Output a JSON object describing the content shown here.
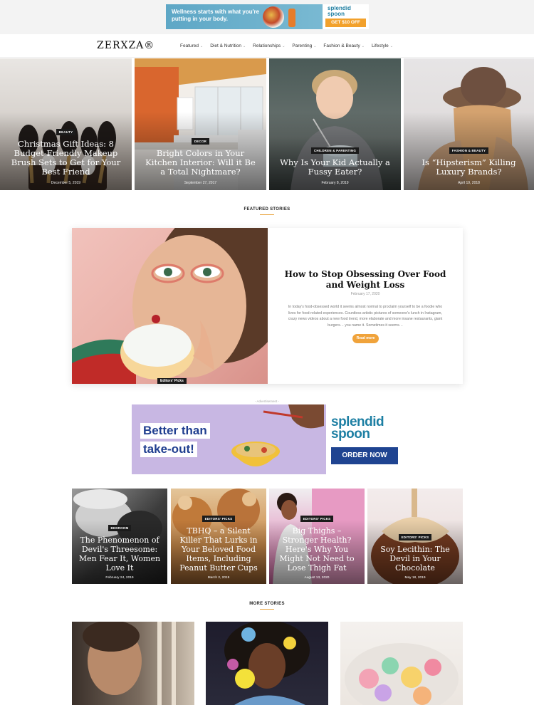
{
  "top_ad": {
    "text": "Wellness starts with what you're putting in your body.",
    "brand": "splendid spoon",
    "cta": "GET $10 OFF"
  },
  "header": {
    "logo": "ZERXZA®",
    "nav": [
      {
        "label": "Featured"
      },
      {
        "label": "Diet & Nutrition"
      },
      {
        "label": "Relationships"
      },
      {
        "label": "Parenting"
      },
      {
        "label": "Fashion & Beauty"
      },
      {
        "label": "Lifestyle"
      }
    ]
  },
  "hero_posts": [
    {
      "category": "BEAUTY",
      "title": "Christmas Gift Ideas: 8 Budget-Friendly Makeup Brush Sets to Get for Your Best Friend",
      "date": "December 5, 2019"
    },
    {
      "category": "DECOR",
      "title": "Bright Colors in Your Kitchen Interior: Will it Be a Total Nightmare?",
      "date": "September 27, 2017"
    },
    {
      "category": "CHILDREN & PARENTING",
      "title": "Why Is Your Kid Actually a Fussy Eater?",
      "date": "February 8, 2019"
    },
    {
      "category": "FASHION & BEAUTY",
      "title": "Is “Hipsterism” Killing Luxury Brands?",
      "date": "April 19, 2018"
    }
  ],
  "featured": {
    "heading": "FEATURED STORIES",
    "title": "How to Stop Obsessing Over Food and Weight Loss",
    "date": "February 17, 2020",
    "excerpt": "In today's food-obsessed world it seems almost normal to proclaim yourself to be a foodie who lives for food-related experiences. Countless artistic pictures of someone's lunch in Instagram, crazy news videos about a new food trend, more elaborate and more insane restaurants, giant burgers… you name it. Sometimes it seems…",
    "button": "Read more",
    "badge": "Editors' Picks"
  },
  "mid_ad": {
    "label": "- Advertisement -",
    "line1": "Better than",
    "line2": "take-out!",
    "brand_line1": "splendid",
    "brand_line2": "spoon",
    "cta": "ORDER NOW"
  },
  "grid_posts": [
    {
      "category": "BEDROOM",
      "title": "The Phenomenon of Devil's Threesome: Men Fear It, Women Love It",
      "date": "February 24, 2019"
    },
    {
      "category": "EDITORS' PICKS",
      "title": "TBHQ – a Silent Killer That Lurks in Your Beloved Food Items, Including Peanut Butter Cups",
      "date": "March 2, 2019"
    },
    {
      "category": "EDITORS' PICKS",
      "title": "Big Thighs – Stronger Health? Here's Why You Might Not Need to Lose Thigh Fat",
      "date": "August 13, 2020"
    },
    {
      "category": "EDITORS' PICKS",
      "title": "Soy Lecithin: The Devil in Your Chocolate",
      "date": "May 18, 2019"
    }
  ],
  "more": {
    "heading": "MORE STORIES"
  }
}
